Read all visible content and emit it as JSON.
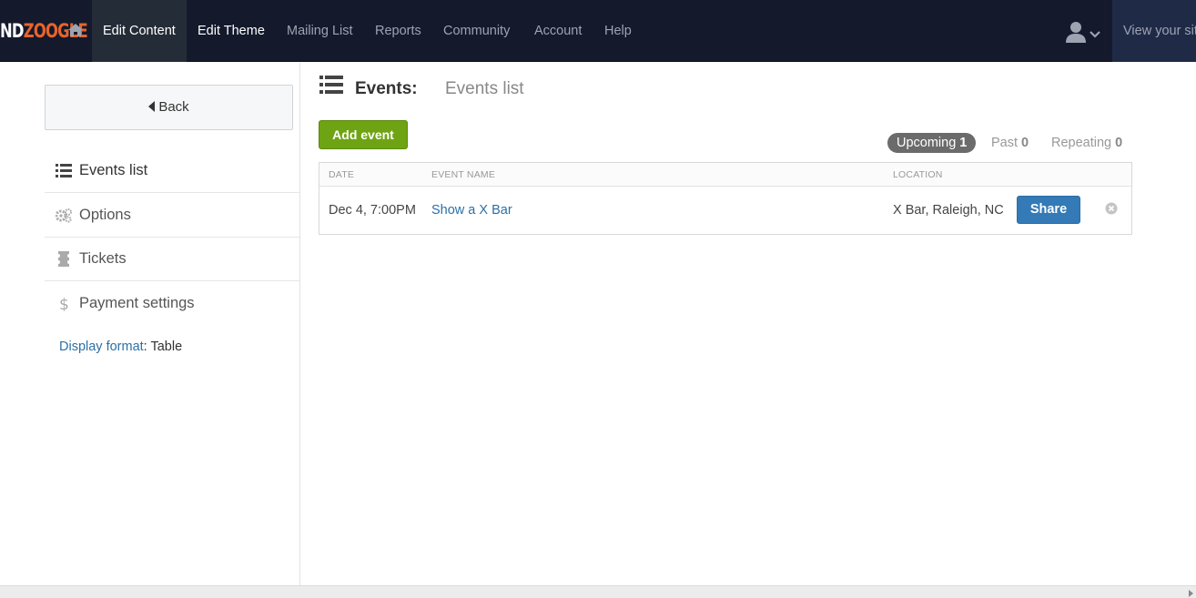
{
  "topnav": {
    "logo_part1": "ND",
    "logo_part2": "ZOOGLE",
    "items": [
      "Edit Content",
      "Edit Theme",
      "Mailing List",
      "Reports",
      "Community",
      "Account",
      "Help"
    ],
    "active_item": "Edit Content",
    "view_site": "View your sit"
  },
  "sidebar": {
    "back_label": "Back",
    "items": [
      {
        "label": "Events list",
        "icon": "list-icon"
      },
      {
        "label": "Options",
        "icon": "gears-icon"
      },
      {
        "label": "Tickets",
        "icon": "ticket-icon"
      },
      {
        "label": "Payment settings",
        "icon": "dollar-icon"
      }
    ],
    "display_format_link": "Display format",
    "display_format_sep": ":",
    "display_format_value": " Table"
  },
  "main": {
    "title_section": "Events:",
    "title_page": "Events list",
    "add_event_label": "Add event",
    "filters": [
      {
        "label": "Upcoming",
        "count": "1"
      },
      {
        "label": "Past",
        "count": "0"
      },
      {
        "label": "Repeating",
        "count": "0"
      }
    ],
    "table": {
      "headers": [
        "Date",
        "Event name",
        "Location"
      ],
      "rows": [
        {
          "date": "Dec 4, 7:00PM",
          "event_name": "Show a X Bar",
          "location": "X Bar, Raleigh, NC",
          "action": "Share"
        }
      ]
    }
  },
  "colors": {
    "topbar_bg": "#14192c",
    "logo_accent": "#e8642a",
    "add_event_green": "#6ea413",
    "share_blue": "#337ab7",
    "link_blue": "#2a70a8"
  }
}
